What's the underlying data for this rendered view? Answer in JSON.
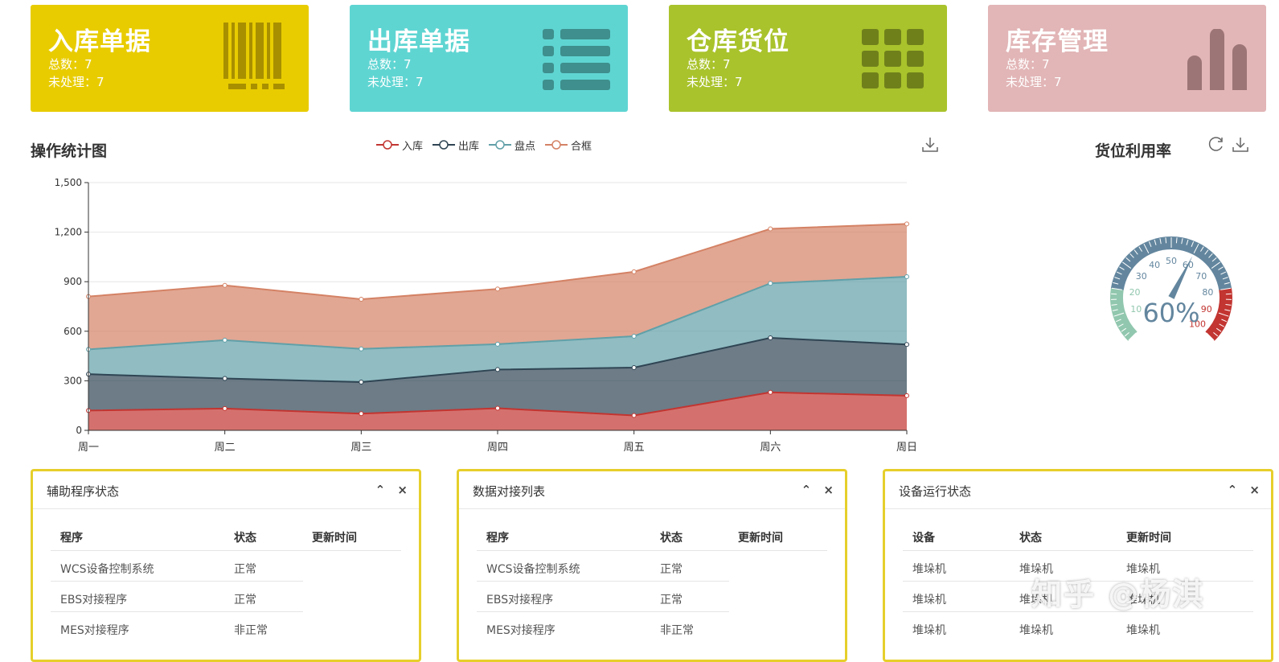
{
  "cards": [
    {
      "title": "入库单据",
      "total_label": "总数：7",
      "pending_label": "未处理：7",
      "color": "#e8cc00",
      "icon": "barcode-icon"
    },
    {
      "title": "出库单据",
      "total_label": "总数：7",
      "pending_label": "未处理：7",
      "color": "#5fd5d2",
      "icon": "list-icon"
    },
    {
      "title": "仓库货位",
      "total_label": "总数：7",
      "pending_label": "未处理：7",
      "color": "#a9c32c",
      "icon": "grid-icon"
    },
    {
      "title": "库存管理",
      "total_label": "总数：7",
      "pending_label": "未处理：7",
      "color": "#e2b5b6",
      "icon": "bar-chart-icon"
    }
  ],
  "op_chart": {
    "title": "操作统计图",
    "legend": [
      "入库",
      "出库",
      "盘点",
      "合框"
    ]
  },
  "gauge_section": {
    "title": "货位利用率"
  },
  "chart_data": {
    "type": "area",
    "stacked": true,
    "categories": [
      "周一",
      "周二",
      "周三",
      "周四",
      "周五",
      "周六",
      "周日"
    ],
    "yticks": [
      "0",
      "300",
      "600",
      "900",
      "1,200",
      "1,500"
    ],
    "ylim": [
      0,
      1500
    ],
    "grid": true,
    "legend_position": "top-center",
    "series": [
      {
        "name": "入库",
        "values": [
          120,
          132,
          101,
          134,
          90,
          230,
          210
        ],
        "color": "#c23531"
      },
      {
        "name": "出库",
        "values": [
          220,
          182,
          191,
          234,
          290,
          330,
          310
        ],
        "color": "#2f4554"
      },
      {
        "name": "盘点",
        "values": [
          150,
          232,
          201,
          154,
          190,
          330,
          410
        ],
        "color": "#61a0a8"
      },
      {
        "name": "合框",
        "values": [
          320,
          332,
          301,
          334,
          390,
          330,
          320
        ],
        "color": "#d48265"
      }
    ]
  },
  "gauge_data": {
    "type": "gauge",
    "value": 60,
    "value_label": "60%",
    "min": 0,
    "max": 100,
    "tick_labels": [
      "10",
      "20",
      "30",
      "40",
      "50",
      "60",
      "70",
      "80",
      "90",
      "100"
    ],
    "band_colors": [
      "#91c7ae",
      "#63869e",
      "#c23531"
    ]
  },
  "panels": [
    {
      "title": "辅助程序状态",
      "columns": [
        "程序",
        "状态",
        "更新时间"
      ],
      "rows": [
        [
          "WCS设备控制系统",
          "正常",
          ""
        ],
        [
          "EBS对接程序",
          "正常",
          ""
        ],
        [
          "MES对接程序",
          "非正常",
          ""
        ]
      ]
    },
    {
      "title": "数据对接列表",
      "columns": [
        "程序",
        "状态",
        "更新时间"
      ],
      "rows": [
        [
          "WCS设备控制系统",
          "正常",
          ""
        ],
        [
          "EBS对接程序",
          "正常",
          ""
        ],
        [
          "MES对接程序",
          "非正常",
          ""
        ]
      ]
    },
    {
      "title": "设备运行状态",
      "columns": [
        "设备",
        "状态",
        "更新时间"
      ],
      "rows": [
        [
          "堆垛机",
          "堆垛机",
          "堆垛机"
        ],
        [
          "堆垛机",
          "堆垛机",
          "堆垛机"
        ],
        [
          "堆垛机",
          "堆垛机",
          "堆垛机"
        ]
      ]
    }
  ],
  "panel_tools": {
    "collapse": "⌃",
    "close": "×"
  },
  "watermark": "知乎 @杨淇"
}
